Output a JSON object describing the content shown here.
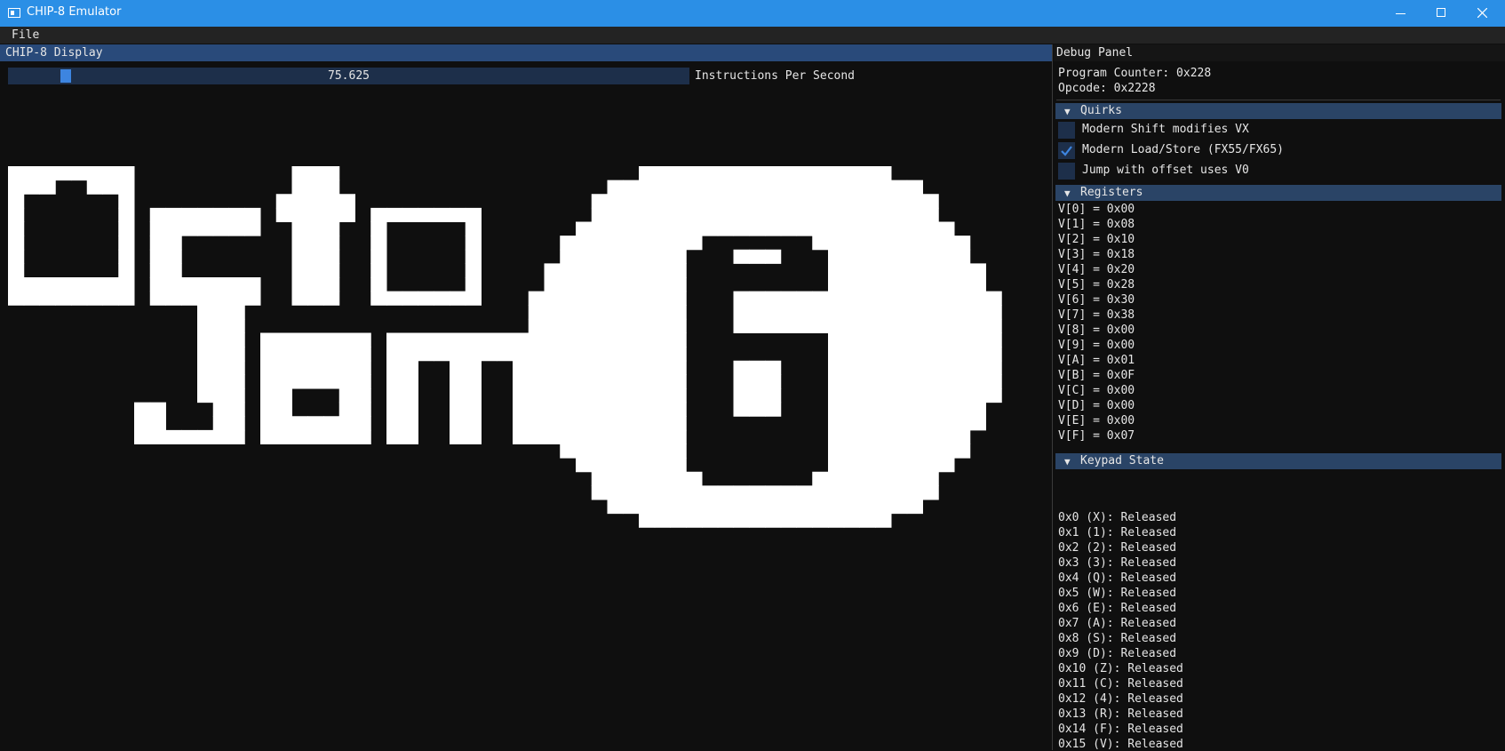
{
  "window": {
    "title": "CHIP-8 Emulator",
    "icon": "app-window-icon",
    "controls": [
      "minimize-icon",
      "maximize-icon",
      "close-icon"
    ]
  },
  "menubar": {
    "file": "File"
  },
  "display": {
    "title": "CHIP-8 Display",
    "ips_value": "75.625",
    "ips_fraction": 0.075,
    "ips_label": "Instructions Per Second",
    "screen_fg": "#ffffff",
    "screen_bg": "#0f0f0f"
  },
  "debug": {
    "title": "Debug Panel",
    "program_counter": "Program Counter: 0x228",
    "opcode": "Opcode: 0x2228",
    "quirks": {
      "title": "Quirks",
      "items": [
        {
          "label": "Modern Shift modifies VX",
          "checked": false
        },
        {
          "label": "Modern Load/Store (FX55/FX65)",
          "checked": true
        },
        {
          "label": "Jump with offset uses V0",
          "checked": false
        }
      ]
    },
    "registers": {
      "title": "Registers",
      "items": [
        "V[0] = 0x00",
        "V[1] = 0x08",
        "V[2] = 0x10",
        "V[3] = 0x18",
        "V[4] = 0x20",
        "V[5] = 0x28",
        "V[6] = 0x30",
        "V[7] = 0x38",
        "V[8] = 0x00",
        "V[9] = 0x00",
        "V[A] = 0x01",
        "V[B] = 0x0F",
        "V[C] = 0x00",
        "V[D] = 0x00",
        "V[E] = 0x00",
        "V[F] = 0x07"
      ]
    },
    "keypad": {
      "title": "Keypad State",
      "items": [
        "0x0 (X): Released",
        "0x1 (1): Released",
        "0x2 (2): Released",
        "0x3 (3): Released",
        "0x4 (Q): Released",
        "0x5 (W): Released",
        "0x6 (E): Released",
        "0x7 (A): Released",
        "0x8 (S): Released",
        "0x9 (D): Released",
        "0x10 (Z): Released",
        "0x11 (C): Released",
        "0x12 (4): Released",
        "0x13 (R): Released",
        "0x14 (F): Released",
        "0x15 (V): Released"
      ]
    }
  },
  "colors": {
    "titlebar": "#2b8fe6",
    "accent": "#3d85e0",
    "header": "#2a4466",
    "active_title": "#294a7a"
  }
}
